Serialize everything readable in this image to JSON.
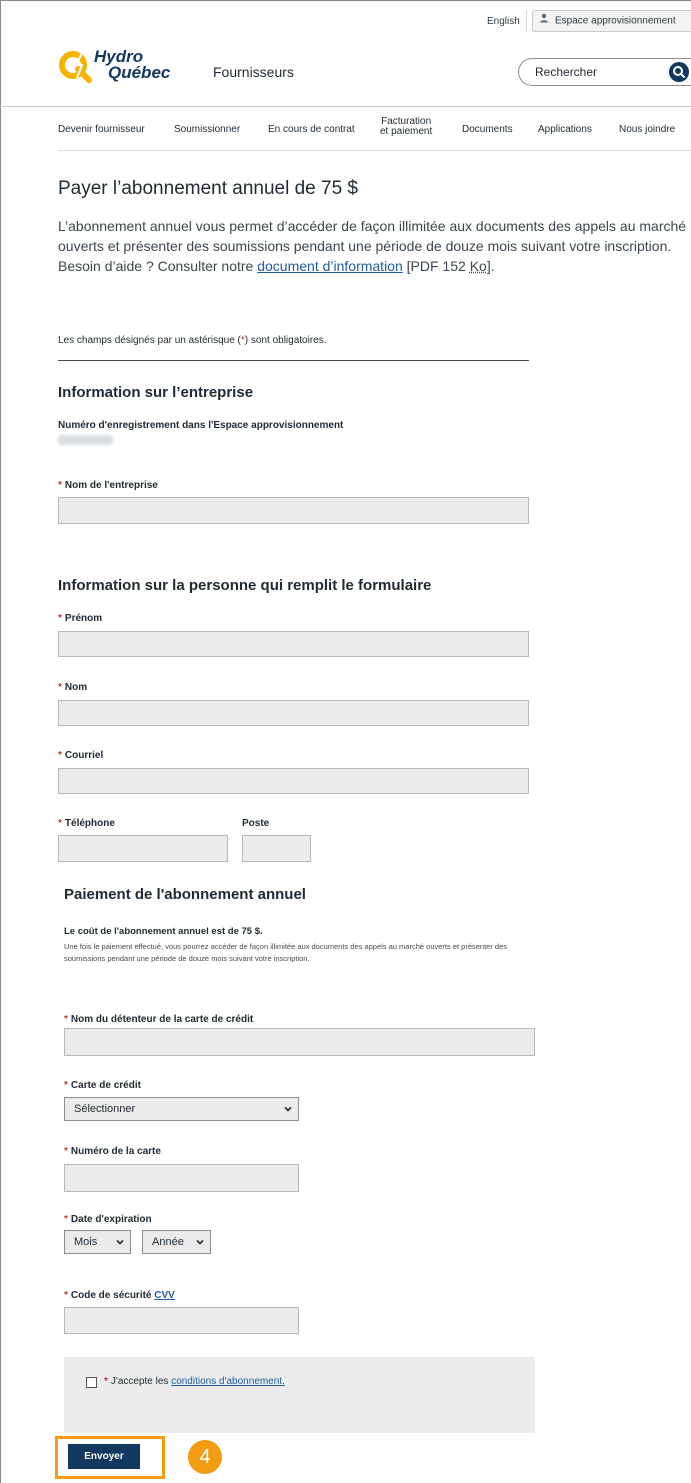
{
  "header": {
    "language_link": "English",
    "espace_button": "Espace approvisionnement",
    "logo_hydro": "Hydro",
    "logo_quebec": "Québec",
    "site_name": "Fournisseurs",
    "search_placeholder": "Rechercher"
  },
  "nav": {
    "items": [
      "Devenir fournisseur",
      "Soumissionner",
      "En cours de contrat",
      "Facturation",
      "et paiement",
      "Documents",
      "Applications",
      "Nous joindre"
    ]
  },
  "page": {
    "title": "Payer l’abonnement annuel de 75 $",
    "intro_line1": "L’abonnement annuel vous permet d’accéder de façon illimitée aux documents des appels au marché ouverts et présenter des soumissions pendant une période de douze mois suivant votre inscription.",
    "intro_help_prefix": "Besoin d’aide ? Consulter notre ",
    "intro_help_link": "document d’information",
    "intro_help_suffix_pre": " [PDF 152 ",
    "intro_help_ko": "Ko",
    "intro_help_suffix_post": "].",
    "required_note_prefix": "Les champs désignés par un astérisque (",
    "required_note_star": "*",
    "required_note_suffix": ") sont obligatoires."
  },
  "company": {
    "section_title": "Information sur l’entreprise",
    "registration_label": "Numéro d'enregistrement dans l'Espace approvisionnement",
    "name_label": "Nom de l'entreprise"
  },
  "person": {
    "section_title": "Information sur la personne qui remplit le formulaire",
    "first_name_label": "Prénom",
    "last_name_label": "Nom",
    "email_label": "Courriel",
    "phone_label": "Téléphone",
    "extension_label": "Poste"
  },
  "payment": {
    "section_title": "Paiement de l'abonnement annuel",
    "cost_line": "Le coût de l'abonnement annuel est de 75 $.",
    "cost_detail": "Une fois le paiement effectué, vous pourrez accéder de façon illimitée aux documents des appels au marché ouverts et présenter des soumissions pendant une période de douze mois suivant votre inscription.",
    "cardholder_label": "Nom du détenteur de la carte de crédit",
    "card_type_label": "Carte de crédit",
    "card_type_value": "Sélectionner",
    "card_number_label": "Numéro de la carte",
    "expiry_label": "Date d'expiration",
    "month_value": "Mois",
    "year_value": "Année",
    "cvv_label_prefix": "Code de sécurité ",
    "cvv_link": "CVV",
    "terms_prefix": "J'accepte les ",
    "terms_link": "conditions d'abonnement.",
    "submit_label": "Envoyer"
  },
  "annotation": {
    "step_number": "4",
    "color": "#f39c12"
  },
  "colors": {
    "brand_navy": "#12385f",
    "logo_yellow": "#f6b400",
    "required_red": "#c0392b",
    "link_blue": "#1f5c99"
  }
}
